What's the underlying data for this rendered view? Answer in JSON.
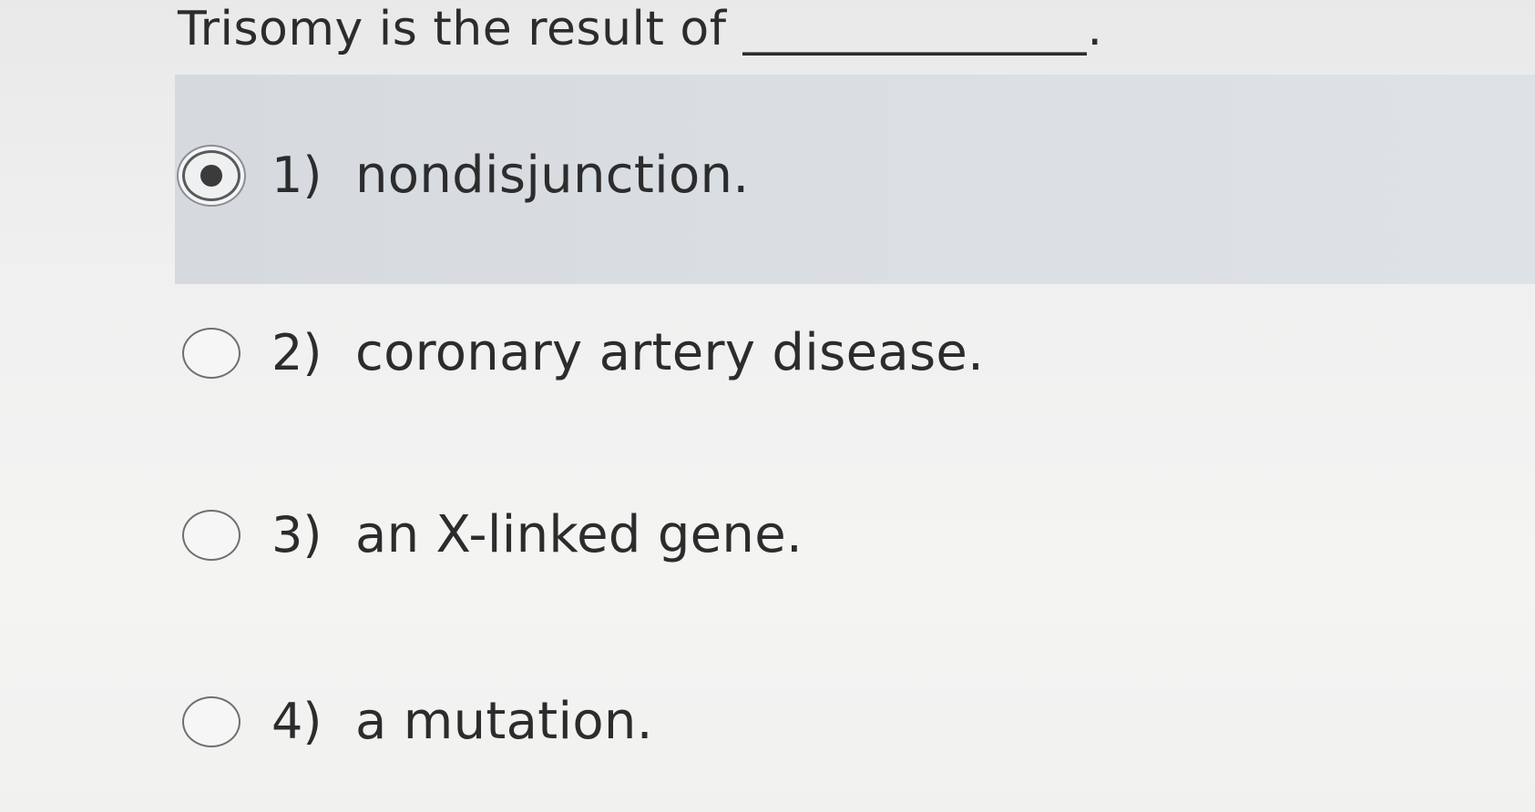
{
  "question": {
    "text": "Trisomy is the result of",
    "blank": "______________."
  },
  "options": [
    {
      "number": "1)",
      "label": "nondisjunction.",
      "selected": true
    },
    {
      "number": "2)",
      "label": "coronary artery disease.",
      "selected": false
    },
    {
      "number": "3)",
      "label": "an X-linked gene.",
      "selected": false
    },
    {
      "number": "4)",
      "label": "a mutation.",
      "selected": false
    }
  ],
  "colors": {
    "selected_band": "#d9dee2",
    "text": "#2c2c2c",
    "radio_border": "#6f6f6f"
  },
  "icons": {
    "selected": "radio-selected-icon",
    "unselected": "radio-empty-icon"
  }
}
